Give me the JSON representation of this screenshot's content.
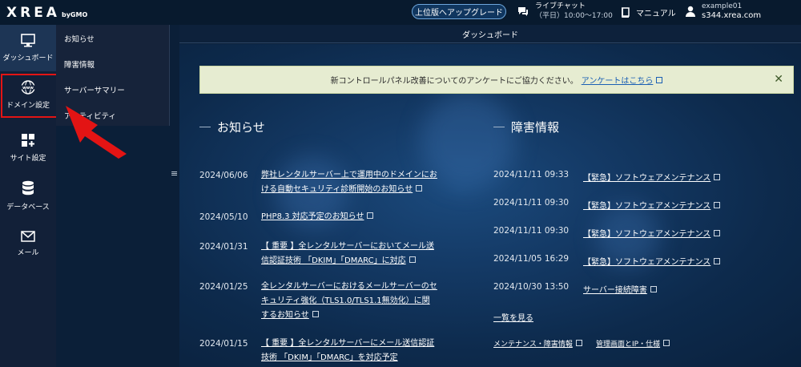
{
  "header": {
    "brand": "XREA",
    "brand_by": "byGMO",
    "upgrade_label": "上位版へアップグレード",
    "chat_title": "ライブチャット",
    "chat_hours": "（平日）10:00～17:00",
    "manual_label": "マニュアル",
    "account_user": "example01",
    "account_server": "s344.xrea.com"
  },
  "sidebar": {
    "items": [
      {
        "label": "ダッシュボード",
        "icon": "monitor-icon"
      },
      {
        "label": "ドメイン設定",
        "icon": "www-globe-icon"
      },
      {
        "label": "サイト設定",
        "icon": "grid-plus-icon"
      },
      {
        "label": "データベース",
        "icon": "database-icon"
      },
      {
        "label": "メール",
        "icon": "envelope-icon"
      }
    ]
  },
  "submenu": {
    "items": [
      "お知らせ",
      "障害情報",
      "サーバーサマリー",
      "アクティビティ"
    ]
  },
  "main": {
    "header_title": "ダッシュボード",
    "notice_text": "新コントロールパネル改善についてのアンケートにご協力ください。",
    "notice_link": "アンケートはこちら",
    "notice_close": "✕",
    "news_title": "お知らせ",
    "news": [
      {
        "date": "2024/06/06",
        "line1": "弊社レンタルサーバー上で運用中のドメインにお",
        "line2": "ける自動セキュリティ診断開始のお知らせ",
        "line3": ""
      },
      {
        "date": "2024/05/10",
        "line1": "PHP8.3 対応予定のお知らせ",
        "line2": "",
        "line3": ""
      },
      {
        "date": "2024/01/31",
        "line1": "【 重要 】全レンタルサーバーにおいてメール送",
        "line2": "信認証技術 「DKIM」「DMARC」に対応",
        "line3": ""
      },
      {
        "date": "2024/01/25",
        "line1": "全レンタルサーバーにおけるメールサーバーのセ",
        "line2": "キュリティ強化（TLS1.0/TLS1.1無効化）に関",
        "line3": "するお知らせ"
      },
      {
        "date": "2024/01/15",
        "line1": "【 重要 】全レンタルサーバーにメール送信認証",
        "line2": "技術 「DKIM」「DMARC」を対応予定",
        "line3": ""
      }
    ],
    "incidents_title": "障害情報",
    "incidents": [
      {
        "date": "2024/11/11 09:33",
        "title": "【緊急】ソフトウェアメンテナンス"
      },
      {
        "date": "2024/11/11 09:30",
        "title": "【緊急】ソフトウェアメンテナンス"
      },
      {
        "date": "2024/11/11 09:30",
        "title": "【緊急】ソフトウェアメンテナンス"
      },
      {
        "date": "2024/11/05 16:29",
        "title": "【緊急】ソフトウェアメンテナンス"
      },
      {
        "date": "2024/10/30 13:50",
        "title": "サーバー接続障害"
      }
    ],
    "more_label": "一覧を見る",
    "footer_links": [
      "メンテナンス・障害情報",
      "管理画面とIP・仕様"
    ]
  },
  "colors": {
    "accent_red": "#e31414",
    "notice_bg": "#e6ecd1",
    "link_blue": "#1a5fb4"
  }
}
